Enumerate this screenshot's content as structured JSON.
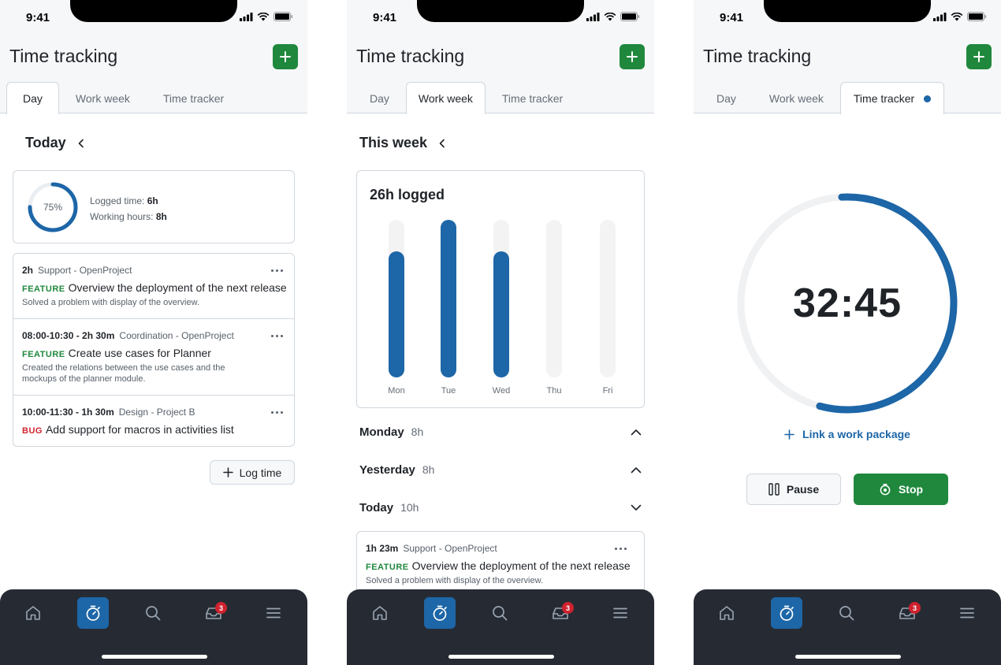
{
  "status_time": "9:41",
  "app_title": "Time tracking",
  "tabs": {
    "day": "Day",
    "work_week": "Work week",
    "time_tracker": "Time tracker"
  },
  "day_view": {
    "heading": "Today",
    "summary": {
      "progress_label": "75%",
      "progress_fraction": 0.75,
      "logged_label": "Logged time:",
      "logged_value": "6h",
      "working_label": "Working hours:",
      "working_value": "8h"
    },
    "entries": [
      {
        "time": "2h",
        "project": "Support - OpenProject",
        "type": "FEATURE",
        "title": "Overview the deployment of the next release",
        "description": "Solved a problem with display of the overview."
      },
      {
        "time": "08:00-10:30 - 2h 30m",
        "project": "Coordination - OpenProject",
        "type": "FEATURE",
        "title": "Create use cases for Planner",
        "description": "Created the relations between the use cases and the mockups of the planner module."
      },
      {
        "time": "10:00-11:30 - 1h 30m",
        "project": "Design - Project B",
        "type": "BUG",
        "title": "Add support for macros in activities list",
        "description": ""
      }
    ],
    "log_button": "Log time"
  },
  "week_view": {
    "heading": "This week",
    "total": "26h logged",
    "days": [
      {
        "label": "Mon",
        "name": "Monday",
        "hours": "8h",
        "expanded": true
      },
      {
        "label": "Yesterday",
        "name": "Yesterday",
        "hours": "8h",
        "expanded": true
      },
      {
        "label": "Today",
        "name": "Today",
        "hours": "10h",
        "expanded": false
      }
    ],
    "entry": {
      "time": "1h 23m",
      "project": "Support - OpenProject",
      "type": "FEATURE",
      "title": "Overview the deployment of the next release",
      "description": "Solved a problem with display of the overview."
    }
  },
  "chart_data": {
    "type": "bar",
    "categories": [
      "Mon",
      "Tue",
      "Wed",
      "Thu",
      "Fri"
    ],
    "values": [
      8,
      10,
      8,
      0,
      0
    ],
    "ylim": [
      0,
      10
    ],
    "title": "26h logged",
    "xlabel": "",
    "ylabel": "",
    "grid": false,
    "bar_color": "#1d66a7",
    "track_color": "#f3f3f3"
  },
  "tracker_view": {
    "timer": "32:45",
    "progress_fraction": 0.55,
    "link_label": "Link a work package",
    "pause_label": "Pause",
    "stop_label": "Stop"
  },
  "nav": {
    "items": [
      "home-icon",
      "stopwatch-icon",
      "search-icon",
      "inbox-icon",
      "menu-icon"
    ],
    "inbox_badge": "3"
  },
  "colors": {
    "primary": "#1d66a7",
    "success": "#1f883d",
    "danger": "#cf222e",
    "nav_bg": "#262b33"
  }
}
